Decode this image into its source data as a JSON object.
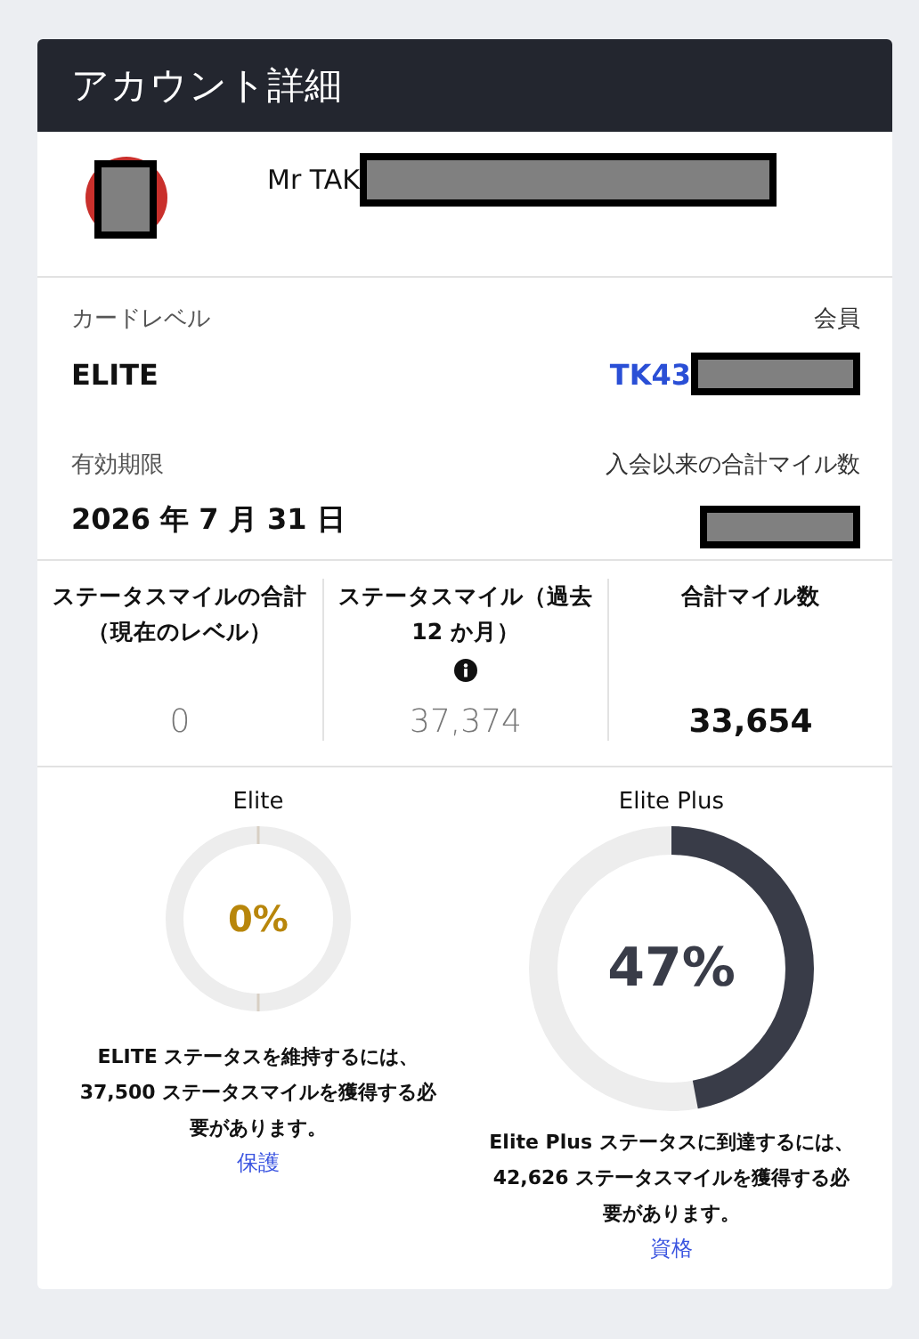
{
  "title": "アカウント詳細",
  "profile": {
    "name": "Mr TAK",
    "redacted": true,
    "avatar_redacted": true
  },
  "details": [
    {
      "label": "カードレベル",
      "value": "ELITE",
      "kind": "plain",
      "redacted": false
    },
    {
      "label": "会員",
      "value": "TK43",
      "kind": "link",
      "redacted": true
    },
    {
      "label": "有効期限",
      "value": "2026 年 7 月 31 日",
      "kind": "plain",
      "redacted": false
    },
    {
      "label": "入会以来の合計マイル数",
      "redacted": true
    }
  ],
  "stats": [
    {
      "label": "ステータスマイルの合計（現在のレベル）",
      "value": "0",
      "emphasis": false,
      "info": false
    },
    {
      "label": "ステータスマイル（過去 12 か月）",
      "value": "37,374",
      "emphasis": false,
      "info": true
    },
    {
      "label": "合計マイル数",
      "value": "33,654",
      "emphasis": true,
      "info": false
    }
  ],
  "progress": [
    {
      "title": "Elite",
      "percent": "0%",
      "level": 0,
      "kind": "small",
      "text": "ELITE ステータスを維持するには、37,500 ステータスマイルを獲得する必要があります。",
      "link": "保護"
    },
    {
      "title": "Elite Plus",
      "percent": "47%",
      "level": 0.47,
      "kind": "large",
      "text": "Elite Plus ステータスに到達するには、42,626 ステータスマイルを獲得する必要があります。",
      "link": "資格"
    }
  ]
}
